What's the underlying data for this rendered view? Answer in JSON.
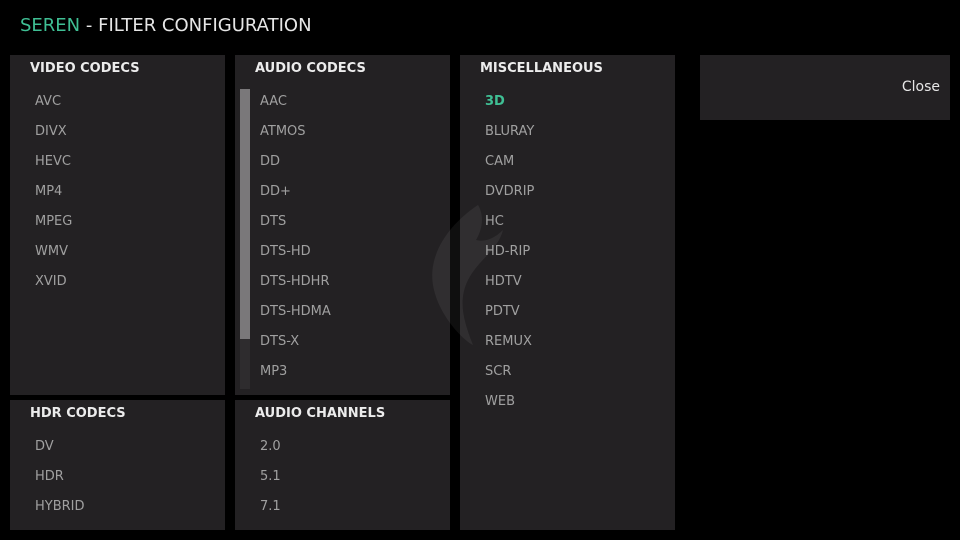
{
  "header": {
    "brand": "SEREN",
    "separator": " - ",
    "title": "FILTER CONFIGURATION"
  },
  "colors": {
    "accent": "#3fbf94",
    "panel_bg": "#232123",
    "page_bg": "#000000",
    "item_text": "#a0a0a0"
  },
  "panels": {
    "video_codecs": {
      "title": "VIDEO CODECS",
      "items": [
        "AVC",
        "DIVX",
        "HEVC",
        "MP4",
        "MPEG",
        "WMV",
        "XVID"
      ]
    },
    "audio_codecs": {
      "title": "AUDIO CODECS",
      "items": [
        "AAC",
        "ATMOS",
        "DD",
        "DD+",
        "DTS",
        "DTS-HD",
        "DTS-HDHR",
        "DTS-HDMA",
        "DTS-X",
        "MP3"
      ]
    },
    "miscellaneous": {
      "title": "MISCELLANEOUS",
      "active_item": "3D",
      "items": [
        "3D",
        "BLURAY",
        "CAM",
        "DVDRIP",
        "HC",
        "HD-RIP",
        "HDTV",
        "PDTV",
        "REMUX",
        "SCR",
        "WEB"
      ]
    },
    "hdr_codecs": {
      "title": "HDR CODECS",
      "items": [
        "DV",
        "HDR",
        "HYBRID"
      ]
    },
    "audio_channels": {
      "title": "AUDIO CHANNELS",
      "items": [
        "2.0",
        "5.1",
        "7.1"
      ]
    }
  },
  "close_button": {
    "label": "Close"
  },
  "icons": {
    "watermark": "seren-logo-watermark"
  }
}
